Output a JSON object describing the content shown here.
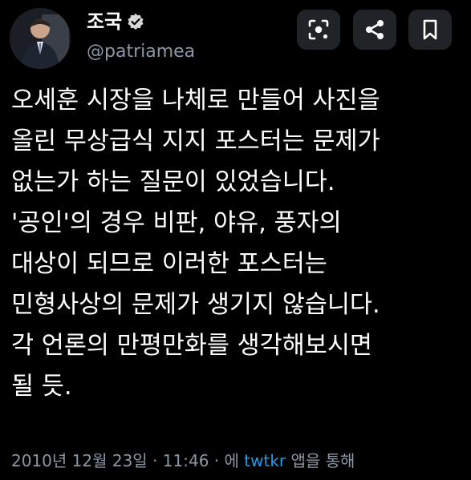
{
  "author": {
    "display_name": "조국",
    "handle": "@patriamea",
    "verified": true
  },
  "actions": {
    "lens_icon": "lens-icon",
    "share_icon": "share-icon",
    "bookmark_icon": "bookmark-icon"
  },
  "tweet": {
    "lines": [
      "오세훈 시장을 나체로 만들어 사진을",
      "올린 무상급식 지지 포스터는 문제가",
      "없는가 하는 질문이 있었습니다.",
      "'공인'의 경우 비판, 야유, 풍자의",
      "대상이 되므로 이러한 포스터는",
      "민형사상의 문제가 생기지 않습니다.",
      "각 언론의 만평만화를 생각해보시면",
      "될 듯."
    ]
  },
  "meta": {
    "date": "2010년 12월 23일",
    "sep1": " · ",
    "time": "11:46",
    "sep2": " · ",
    "via_prefix": "에 ",
    "via_app": "twtkr",
    "via_suffix": " 앱을 통해"
  },
  "colors": {
    "background": "#000000",
    "text": "#ffffff",
    "muted": "#8b98a5",
    "link": "#1d9bf0",
    "button_bg": "#202327"
  }
}
